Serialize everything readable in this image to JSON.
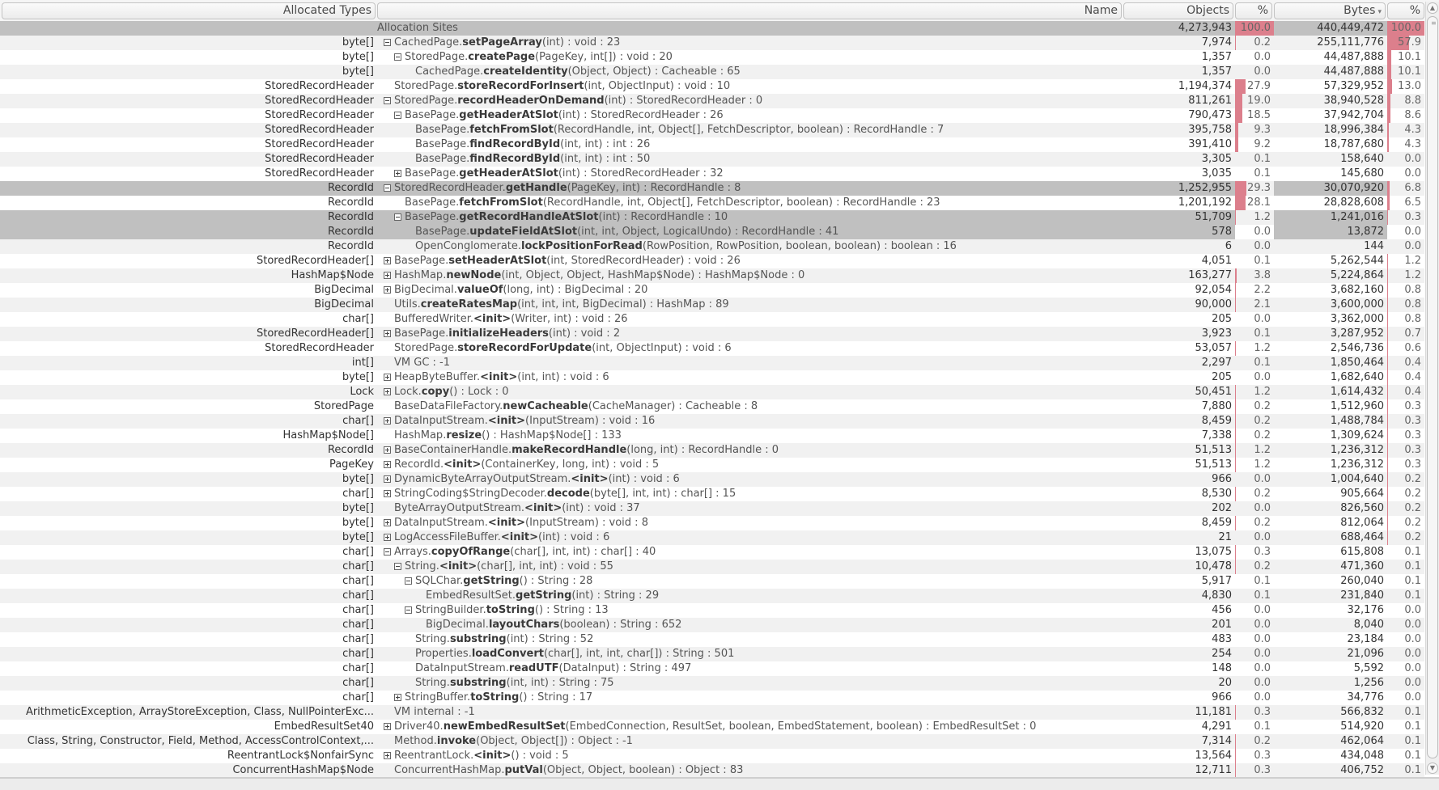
{
  "columns": {
    "types": "Allocated Types",
    "name": "Name",
    "objects": "Objects",
    "objects_pct": "%",
    "bytes": "Bytes",
    "bytes_pct": "%",
    "sort_indicator": "▾"
  },
  "heat_color": "#dc7f8c",
  "selection_color": "#c0c0c0",
  "root": {
    "name": "Allocation Sites",
    "objects": "4,273,943",
    "objects_pct": "100.0",
    "bytes": "440,449,472",
    "bytes_pct": "100.0"
  },
  "rows": [
    {
      "type": "byte[]",
      "depth": 0,
      "toggle": "minus",
      "cls": "CachedPage.",
      "method": "setPageArray",
      "sig": "(int) : void : 23",
      "objects": "7,974",
      "objects_pct": "0.2",
      "bytes": "255,111,776",
      "bytes_pct": "57.9"
    },
    {
      "type": "byte[]",
      "depth": 1,
      "toggle": "minus",
      "cls": "StoredPage.",
      "method": "createPage",
      "sig": "(PageKey, int[]) : void : 20",
      "objects": "1,357",
      "objects_pct": "0.0",
      "bytes": "44,487,888",
      "bytes_pct": "10.1"
    },
    {
      "type": "byte[]",
      "depth": 2,
      "toggle": "none",
      "cls": "CachedPage.",
      "method": "createIdentity",
      "sig": "(Object, Object) : Cacheable : 65",
      "objects": "1,357",
      "objects_pct": "0.0",
      "bytes": "44,487,888",
      "bytes_pct": "10.1"
    },
    {
      "type": "StoredRecordHeader",
      "depth": 0,
      "toggle": "none",
      "cls": "StoredPage.",
      "method": "storeRecordForInsert",
      "sig": "(int, ObjectInput) : void : 10",
      "objects": "1,194,374",
      "objects_pct": "27.9",
      "bytes": "57,329,952",
      "bytes_pct": "13.0"
    },
    {
      "type": "StoredRecordHeader",
      "depth": 0,
      "toggle": "minus",
      "cls": "StoredPage.",
      "method": "recordHeaderOnDemand",
      "sig": "(int) : StoredRecordHeader : 0",
      "objects": "811,261",
      "objects_pct": "19.0",
      "bytes": "38,940,528",
      "bytes_pct": "8.8"
    },
    {
      "type": "StoredRecordHeader",
      "depth": 1,
      "toggle": "minus",
      "cls": "BasePage.",
      "method": "getHeaderAtSlot",
      "sig": "(int) : StoredRecordHeader : 26",
      "objects": "790,473",
      "objects_pct": "18.5",
      "bytes": "37,942,704",
      "bytes_pct": "8.6"
    },
    {
      "type": "StoredRecordHeader",
      "depth": 2,
      "toggle": "none",
      "cls": "BasePage.",
      "method": "fetchFromSlot",
      "sig": "(RecordHandle, int, Object[], FetchDescriptor, boolean) : RecordHandle : 7",
      "objects": "395,758",
      "objects_pct": "9.3",
      "bytes": "18,996,384",
      "bytes_pct": "4.3"
    },
    {
      "type": "StoredRecordHeader",
      "depth": 2,
      "toggle": "none",
      "cls": "BasePage.",
      "method": "findRecordById",
      "sig": "(int, int) : int : 26",
      "objects": "391,410",
      "objects_pct": "9.2",
      "bytes": "18,787,680",
      "bytes_pct": "4.3"
    },
    {
      "type": "StoredRecordHeader",
      "depth": 2,
      "toggle": "none",
      "cls": "BasePage.",
      "method": "findRecordById",
      "sig": "(int, int) : int : 50",
      "objects": "3,305",
      "objects_pct": "0.1",
      "bytes": "158,640",
      "bytes_pct": "0.0"
    },
    {
      "type": "StoredRecordHeader",
      "depth": 1,
      "toggle": "plus",
      "cls": "BasePage.",
      "method": "getHeaderAtSlot",
      "sig": "(int) : StoredRecordHeader : 32",
      "objects": "3,035",
      "objects_pct": "0.1",
      "bytes": "145,680",
      "bytes_pct": "0.0"
    },
    {
      "type": "RecordId",
      "depth": 0,
      "toggle": "minus",
      "cls": "StoredRecordHeader.",
      "method": "getHandle",
      "sig": "(PageKey, int) : RecordHandle : 8",
      "objects": "1,252,955",
      "objects_pct": "29.3",
      "bytes": "30,070,920",
      "bytes_pct": "6.8",
      "selected": true
    },
    {
      "type": "RecordId",
      "depth": 1,
      "toggle": "none",
      "cls": "BasePage.",
      "method": "fetchFromSlot",
      "sig": "(RecordHandle, int, Object[], FetchDescriptor, boolean) : RecordHandle : 23",
      "objects": "1,201,192",
      "objects_pct": "28.1",
      "bytes": "28,828,608",
      "bytes_pct": "6.5"
    },
    {
      "type": "RecordId",
      "depth": 1,
      "toggle": "minus",
      "cls": "BasePage.",
      "method": "getRecordHandleAtSlot",
      "sig": "(int) : RecordHandle : 10",
      "objects": "51,709",
      "objects_pct": "1.2",
      "bytes": "1,241,016",
      "bytes_pct": "0.3",
      "selected": true
    },
    {
      "type": "RecordId",
      "depth": 2,
      "toggle": "none",
      "cls": "BasePage.",
      "method": "updateFieldAtSlot",
      "sig": "(int, int, Object, LogicalUndo) : RecordHandle : 41",
      "objects": "578",
      "objects_pct": "0.0",
      "bytes": "13,872",
      "bytes_pct": "0.0",
      "selected": true
    },
    {
      "type": "RecordId",
      "depth": 2,
      "toggle": "none",
      "cls": "OpenConglomerate.",
      "method": "lockPositionForRead",
      "sig": "(RowPosition, RowPosition, boolean, boolean) : boolean : 16",
      "objects": "6",
      "objects_pct": "0.0",
      "bytes": "144",
      "bytes_pct": "0.0"
    },
    {
      "type": "StoredRecordHeader[]",
      "depth": 0,
      "toggle": "plus",
      "cls": "BasePage.",
      "method": "setHeaderAtSlot",
      "sig": "(int, StoredRecordHeader) : void : 26",
      "objects": "4,051",
      "objects_pct": "0.1",
      "bytes": "5,262,544",
      "bytes_pct": "1.2"
    },
    {
      "type": "HashMap$Node",
      "depth": 0,
      "toggle": "plus",
      "cls": "HashMap.",
      "method": "newNode",
      "sig": "(int, Object, Object, HashMap$Node) : HashMap$Node : 0",
      "objects": "163,277",
      "objects_pct": "3.8",
      "bytes": "5,224,864",
      "bytes_pct": "1.2"
    },
    {
      "type": "BigDecimal",
      "depth": 0,
      "toggle": "plus",
      "cls": "BigDecimal.",
      "method": "valueOf",
      "sig": "(long, int) : BigDecimal : 20",
      "objects": "92,054",
      "objects_pct": "2.2",
      "bytes": "3,682,160",
      "bytes_pct": "0.8"
    },
    {
      "type": "BigDecimal",
      "depth": 0,
      "toggle": "none",
      "cls": "Utils.",
      "method": "createRatesMap",
      "sig": "(int, int, int, BigDecimal) : HashMap : 89",
      "objects": "90,000",
      "objects_pct": "2.1",
      "bytes": "3,600,000",
      "bytes_pct": "0.8"
    },
    {
      "type": "char[]",
      "depth": 0,
      "toggle": "none",
      "cls": "BufferedWriter.",
      "method": "<init>",
      "sig": "(Writer, int) : void : 26",
      "objects": "205",
      "objects_pct": "0.0",
      "bytes": "3,362,000",
      "bytes_pct": "0.8"
    },
    {
      "type": "StoredRecordHeader[]",
      "depth": 0,
      "toggle": "plus",
      "cls": "BasePage.",
      "method": "initializeHeaders",
      "sig": "(int) : void : 2",
      "objects": "3,923",
      "objects_pct": "0.1",
      "bytes": "3,287,952",
      "bytes_pct": "0.7"
    },
    {
      "type": "StoredRecordHeader",
      "depth": 0,
      "toggle": "none",
      "cls": "StoredPage.",
      "method": "storeRecordForUpdate",
      "sig": "(int, ObjectInput) : void : 6",
      "objects": "53,057",
      "objects_pct": "1.2",
      "bytes": "2,546,736",
      "bytes_pct": "0.6"
    },
    {
      "type": "int[]",
      "depth": 0,
      "toggle": "none",
      "cls": "VM GC : -1",
      "method": "",
      "sig": "",
      "objects": "2,297",
      "objects_pct": "0.1",
      "bytes": "1,850,464",
      "bytes_pct": "0.4"
    },
    {
      "type": "byte[]",
      "depth": 0,
      "toggle": "plus",
      "cls": "HeapByteBuffer.",
      "method": "<init>",
      "sig": "(int, int) : void : 6",
      "objects": "205",
      "objects_pct": "0.0",
      "bytes": "1,682,640",
      "bytes_pct": "0.4"
    },
    {
      "type": "Lock",
      "depth": 0,
      "toggle": "plus",
      "cls": "Lock.",
      "method": "copy",
      "sig": "() : Lock : 0",
      "objects": "50,451",
      "objects_pct": "1.2",
      "bytes": "1,614,432",
      "bytes_pct": "0.4"
    },
    {
      "type": "StoredPage",
      "depth": 0,
      "toggle": "none",
      "cls": "BaseDataFileFactory.",
      "method": "newCacheable",
      "sig": "(CacheManager) : Cacheable : 8",
      "objects": "7,880",
      "objects_pct": "0.2",
      "bytes": "1,512,960",
      "bytes_pct": "0.3"
    },
    {
      "type": "char[]",
      "depth": 0,
      "toggle": "plus",
      "cls": "DataInputStream.",
      "method": "<init>",
      "sig": "(InputStream) : void : 16",
      "objects": "8,459",
      "objects_pct": "0.2",
      "bytes": "1,488,784",
      "bytes_pct": "0.3"
    },
    {
      "type": "HashMap$Node[]",
      "depth": 0,
      "toggle": "none",
      "cls": "HashMap.",
      "method": "resize",
      "sig": "() : HashMap$Node[] : 133",
      "objects": "7,338",
      "objects_pct": "0.2",
      "bytes": "1,309,624",
      "bytes_pct": "0.3"
    },
    {
      "type": "RecordId",
      "depth": 0,
      "toggle": "plus",
      "cls": "BaseContainerHandle.",
      "method": "makeRecordHandle",
      "sig": "(long, int) : RecordHandle : 0",
      "objects": "51,513",
      "objects_pct": "1.2",
      "bytes": "1,236,312",
      "bytes_pct": "0.3"
    },
    {
      "type": "PageKey",
      "depth": 0,
      "toggle": "plus",
      "cls": "RecordId.",
      "method": "<init>",
      "sig": "(ContainerKey, long, int) : void : 5",
      "objects": "51,513",
      "objects_pct": "1.2",
      "bytes": "1,236,312",
      "bytes_pct": "0.3"
    },
    {
      "type": "byte[]",
      "depth": 0,
      "toggle": "plus",
      "cls": "DynamicByteArrayOutputStream.",
      "method": "<init>",
      "sig": "(int) : void : 6",
      "objects": "966",
      "objects_pct": "0.0",
      "bytes": "1,004,640",
      "bytes_pct": "0.2"
    },
    {
      "type": "char[]",
      "depth": 0,
      "toggle": "plus",
      "cls": "StringCoding$StringDecoder.",
      "method": "decode",
      "sig": "(byte[], int, int) : char[] : 15",
      "objects": "8,530",
      "objects_pct": "0.2",
      "bytes": "905,664",
      "bytes_pct": "0.2"
    },
    {
      "type": "byte[]",
      "depth": 0,
      "toggle": "none",
      "cls": "ByteArrayOutputStream.",
      "method": "<init>",
      "sig": "(int) : void : 37",
      "objects": "202",
      "objects_pct": "0.0",
      "bytes": "826,560",
      "bytes_pct": "0.2"
    },
    {
      "type": "byte[]",
      "depth": 0,
      "toggle": "plus",
      "cls": "DataInputStream.",
      "method": "<init>",
      "sig": "(InputStream) : void : 8",
      "objects": "8,459",
      "objects_pct": "0.2",
      "bytes": "812,064",
      "bytes_pct": "0.2"
    },
    {
      "type": "byte[]",
      "depth": 0,
      "toggle": "plus",
      "cls": "LogAccessFileBuffer.",
      "method": "<init>",
      "sig": "(int) : void : 6",
      "objects": "21",
      "objects_pct": "0.0",
      "bytes": "688,464",
      "bytes_pct": "0.2"
    },
    {
      "type": "char[]",
      "depth": 0,
      "toggle": "minus",
      "cls": "Arrays.",
      "method": "copyOfRange",
      "sig": "(char[], int, int) : char[] : 40",
      "objects": "13,075",
      "objects_pct": "0.3",
      "bytes": "615,808",
      "bytes_pct": "0.1"
    },
    {
      "type": "char[]",
      "depth": 1,
      "toggle": "minus",
      "cls": "String.",
      "method": "<init>",
      "sig": "(char[], int, int) : void : 55",
      "objects": "10,478",
      "objects_pct": "0.2",
      "bytes": "471,360",
      "bytes_pct": "0.1"
    },
    {
      "type": "char[]",
      "depth": 2,
      "toggle": "minus",
      "cls": "SQLChar.",
      "method": "getString",
      "sig": "() : String : 28",
      "objects": "5,917",
      "objects_pct": "0.1",
      "bytes": "260,040",
      "bytes_pct": "0.1"
    },
    {
      "type": "char[]",
      "depth": 3,
      "toggle": "none",
      "cls": "EmbedResultSet.",
      "method": "getString",
      "sig": "(int) : String : 29",
      "objects": "4,830",
      "objects_pct": "0.1",
      "bytes": "231,840",
      "bytes_pct": "0.1"
    },
    {
      "type": "char[]",
      "depth": 2,
      "toggle": "minus",
      "cls": "StringBuilder.",
      "method": "toString",
      "sig": "() : String : 13",
      "objects": "456",
      "objects_pct": "0.0",
      "bytes": "32,176",
      "bytes_pct": "0.0"
    },
    {
      "type": "char[]",
      "depth": 3,
      "toggle": "none",
      "cls": "BigDecimal.",
      "method": "layoutChars",
      "sig": "(boolean) : String : 652",
      "objects": "201",
      "objects_pct": "0.0",
      "bytes": "8,040",
      "bytes_pct": "0.0"
    },
    {
      "type": "char[]",
      "depth": 2,
      "toggle": "none",
      "cls": "String.",
      "method": "substring",
      "sig": "(int) : String : 52",
      "objects": "483",
      "objects_pct": "0.0",
      "bytes": "23,184",
      "bytes_pct": "0.0"
    },
    {
      "type": "char[]",
      "depth": 2,
      "toggle": "none",
      "cls": "Properties.",
      "method": "loadConvert",
      "sig": "(char[], int, int, char[]) : String : 501",
      "objects": "254",
      "objects_pct": "0.0",
      "bytes": "21,096",
      "bytes_pct": "0.0"
    },
    {
      "type": "char[]",
      "depth": 2,
      "toggle": "none",
      "cls": "DataInputStream.",
      "method": "readUTF",
      "sig": "(DataInput) : String : 497",
      "objects": "148",
      "objects_pct": "0.0",
      "bytes": "5,592",
      "bytes_pct": "0.0"
    },
    {
      "type": "char[]",
      "depth": 2,
      "toggle": "none",
      "cls": "String.",
      "method": "substring",
      "sig": "(int, int) : String : 75",
      "objects": "20",
      "objects_pct": "0.0",
      "bytes": "1,256",
      "bytes_pct": "0.0"
    },
    {
      "type": "char[]",
      "depth": 1,
      "toggle": "plus",
      "cls": "StringBuffer.",
      "method": "toString",
      "sig": "() : String : 17",
      "objects": "966",
      "objects_pct": "0.0",
      "bytes": "34,776",
      "bytes_pct": "0.0"
    },
    {
      "type": "ArithmeticException, ArrayStoreException, Class, NullPointerExc...",
      "depth": 0,
      "toggle": "none",
      "cls": "VM internal : -1",
      "method": "",
      "sig": "",
      "objects": "11,181",
      "objects_pct": "0.3",
      "bytes": "566,832",
      "bytes_pct": "0.1"
    },
    {
      "type": "EmbedResultSet40",
      "depth": 0,
      "toggle": "plus",
      "cls": "Driver40.",
      "method": "newEmbedResultSet",
      "sig": "(EmbedConnection, ResultSet, boolean, EmbedStatement, boolean) : EmbedResultSet : 0",
      "objects": "4,291",
      "objects_pct": "0.1",
      "bytes": "514,920",
      "bytes_pct": "0.1"
    },
    {
      "type": "Class, String, Constructor, Field, Method, AccessControlContext,...",
      "depth": 0,
      "toggle": "none",
      "cls": "Method.",
      "method": "invoke",
      "sig": "(Object, Object[]) : Object : -1",
      "objects": "7,314",
      "objects_pct": "0.2",
      "bytes": "462,064",
      "bytes_pct": "0.1"
    },
    {
      "type": "ReentrantLock$NonfairSync",
      "depth": 0,
      "toggle": "plus",
      "cls": "ReentrantLock.",
      "method": "<init>",
      "sig": "() : void : 5",
      "objects": "13,564",
      "objects_pct": "0.3",
      "bytes": "434,048",
      "bytes_pct": "0.1"
    },
    {
      "type": "ConcurrentHashMap$Node",
      "depth": 0,
      "toggle": "none",
      "cls": "ConcurrentHashMap.",
      "method": "putVal",
      "sig": "(Object, Object, boolean) : Object : 83",
      "objects": "12,711",
      "objects_pct": "0.3",
      "bytes": "406,752",
      "bytes_pct": "0.1"
    }
  ]
}
